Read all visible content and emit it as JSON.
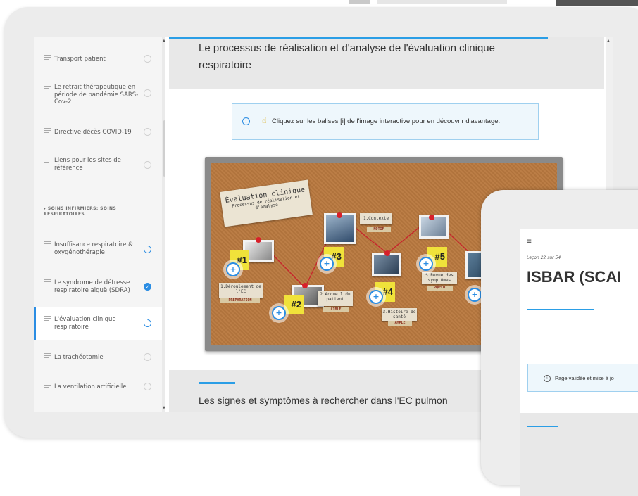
{
  "sidebar": {
    "items": [
      {
        "label": "Transport patient",
        "status": "not-started"
      },
      {
        "label": "Le retrait thérapeutique en période de pandémie SARS-Cov-2",
        "status": "not-started"
      },
      {
        "label": "Directive décès COVID-19",
        "status": "not-started"
      },
      {
        "label": "Liens pour les sites de référence",
        "status": "not-started"
      },
      {
        "label": "Insuffisance respiratoire & oxygénothérapie",
        "status": "in-progress"
      },
      {
        "label": "Le syndrome de détresse respiratoire aiguë (SDRA)",
        "status": "complete"
      },
      {
        "label": "L'évaluation clinique respiratoire",
        "status": "in-progress",
        "active": true
      },
      {
        "label": "La trachéotomie",
        "status": "not-started"
      },
      {
        "label": "La ventilation artificielle",
        "status": "not-started"
      }
    ],
    "section_header": "▾ SOINS INFIRMIERS: SOINS RESPIRATOIRES"
  },
  "main": {
    "title": "Le processus de réalisation et d'analyse de l'évaluation clinique respiratoire",
    "info_text": "Cliquez sur les balises  [i] de l'image interactive pour en découvrir d'avantage.",
    "section_title": "Les signes et symptômes à rechercher dans l'EC pulmon"
  },
  "board": {
    "title_card": {
      "line1": "Évaluation clinique",
      "line2": "Processus de réalisation et d'analyse"
    },
    "notes": [
      {
        "number": "#1",
        "text": "1.Déroulement de l'EC",
        "tag": "PRÉPARATION"
      },
      {
        "number": "#2",
        "text": "2.Accueil du patient",
        "tag": "CIBLE"
      },
      {
        "number": "#3",
        "text": "1.Contexte",
        "tag": "MOTIF"
      },
      {
        "number": "#4",
        "text": "3.Histoire de santé",
        "tag": "AMPLE"
      },
      {
        "number": "#5",
        "text": "5.Revue des symptômes",
        "tag": "PQRSTU"
      }
    ],
    "hotspot_symbol": "+"
  },
  "phone": {
    "menu_icon": "≡",
    "lesson": "Leçon 22 sur 54",
    "title": "ISBAR (SCAI",
    "info_text": "Page validée et mise à jo"
  },
  "icons": {
    "info": "i",
    "hand": "☝",
    "check": "✓",
    "scroll_up": "▲",
    "scroll_down": "▼"
  },
  "colors": {
    "accent": "#2b8de3",
    "cork": "#b9793f",
    "sticky": "#f0e23a",
    "pin": "#d8202a"
  }
}
